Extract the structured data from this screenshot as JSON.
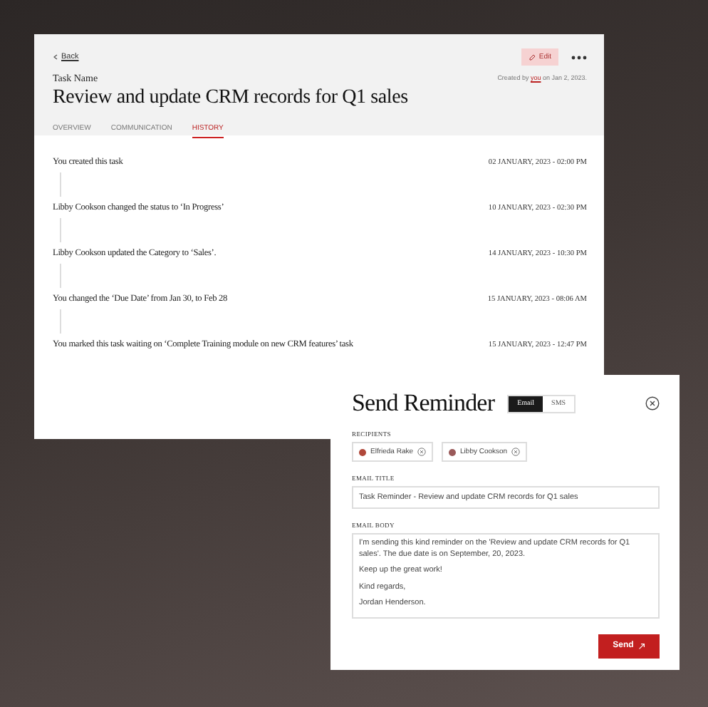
{
  "task": {
    "back_link": "Back",
    "edit_button": "Edit",
    "label": "Task Name",
    "title": "Review and update CRM records for Q1 sales",
    "created_by": {
      "prefix": "Created by",
      "link": "you",
      "suffix": "on Jan 2, 2023."
    },
    "tabs": [
      {
        "label": "OVERVIEW",
        "selected": false
      },
      {
        "label": "COMMUNICATION",
        "selected": false
      },
      {
        "label": "HISTORY",
        "selected": true
      }
    ],
    "history": [
      {
        "text": "You created this task",
        "time": "02 JANUARY, 2023 - 02:00 PM"
      },
      {
        "text": "Libby Cookson changed the status to ‘In Progress’",
        "time": "10 JANUARY, 2023 - 02:30 PM"
      },
      {
        "text": "Libby Cookson updated the Category to ‘Sales’.",
        "time": "14 JANUARY, 2023 - 10:30 PM"
      },
      {
        "text": "You changed the ‘Due Date’ from Jan 30, to Feb 28",
        "time": "15 JANUARY, 2023 - 08:06 AM"
      },
      {
        "text": "You marked this task waiting on ‘Complete Training module on new CRM features’ task",
        "time": "15 JANUARY, 2023 - 12:47 PM"
      }
    ]
  },
  "reminder": {
    "title": "Send Reminder",
    "channels": [
      {
        "label": "Email",
        "selected": true
      },
      {
        "label": "SMS",
        "selected": false
      }
    ],
    "recipients_label": "RECIPIENTS",
    "recipients": [
      {
        "name": "Elfrieda Rake",
        "color": "#b0483a"
      },
      {
        "name": "Libby Cookson",
        "color": "#9a5a5a"
      }
    ],
    "email_title_label": "EMAIL TITLE",
    "email_title": "Task Reminder - Review and update CRM records for Q1 sales",
    "email_body_label": "EMAIL BODY",
    "email_body": [
      "I'm sending this kind reminder on the 'Review and update CRM records for Q1 sales'. The due date is on September, 20, 2023.",
      "Keep up the great work!",
      "Kind regards,",
      "Jordan Henderson."
    ],
    "send_button": "Send"
  }
}
